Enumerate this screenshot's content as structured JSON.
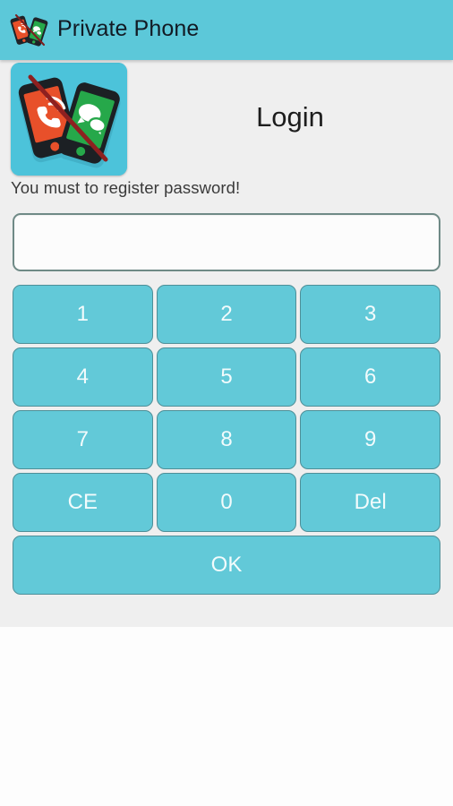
{
  "titlebar": {
    "title": "Private Phone",
    "icon_name": "private-phone-app-icon"
  },
  "screen": {
    "heading": "Login",
    "instruction": "You must to register password!"
  },
  "password_field": {
    "value": "",
    "placeholder": ""
  },
  "keypad": {
    "rows": [
      [
        {
          "label": "1"
        },
        {
          "label": "2"
        },
        {
          "label": "3"
        }
      ],
      [
        {
          "label": "4"
        },
        {
          "label": "5"
        },
        {
          "label": "6"
        }
      ],
      [
        {
          "label": "7"
        },
        {
          "label": "8"
        },
        {
          "label": "9"
        }
      ],
      [
        {
          "label": "CE"
        },
        {
          "label": "0"
        },
        {
          "label": "Del"
        }
      ]
    ],
    "confirm": "OK"
  },
  "colors": {
    "accent_teal": "#5cc8d9",
    "key_teal": "#62c9d8",
    "panel_gray": "#efefef",
    "logo_bg": "#4cc3da",
    "phone_red": "#e8502a",
    "phone_green": "#26a84a",
    "strike_red": "#8e2020",
    "input_border": "#6f8a86",
    "title_text": "#121a24"
  }
}
